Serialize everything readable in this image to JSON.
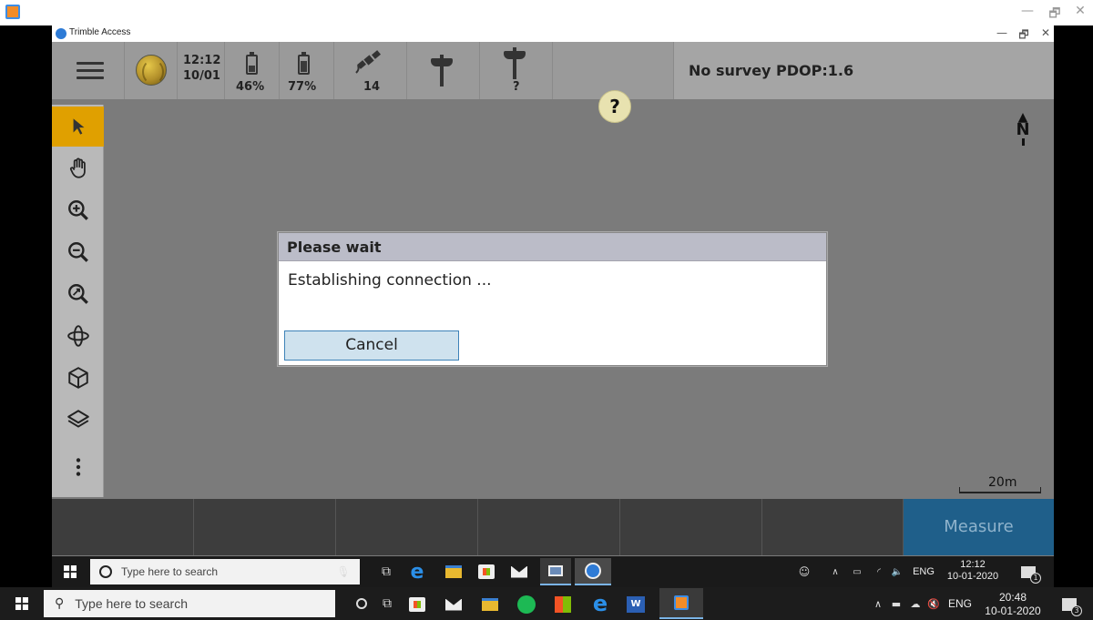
{
  "host": {
    "logo_icon": "app-logo-icon",
    "minimize": "—",
    "maximize": "🗗",
    "close": "✕"
  },
  "window": {
    "title": "Trimble Access",
    "minimize": "—",
    "maximize": "🗗",
    "close": "✕"
  },
  "statusbar": {
    "time": "12:12",
    "date": "10/01",
    "battery1": "46%",
    "battery1_level": 0.46,
    "battery2": "77%",
    "battery2_level": 0.77,
    "satellites": "14",
    "antenna2_label": "?",
    "survey_status": "No survey  PDOP:1.6"
  },
  "help_cursor": "?",
  "toolbar": {
    "items": [
      {
        "name": "select-arrow-icon",
        "active": true
      },
      {
        "name": "pan-hand-icon"
      },
      {
        "name": "zoom-in-icon"
      },
      {
        "name": "zoom-out-icon"
      },
      {
        "name": "zoom-extents-icon"
      },
      {
        "name": "orbit-icon"
      },
      {
        "name": "cube-view-icon"
      },
      {
        "name": "layers-icon"
      },
      {
        "name": "more-icon"
      }
    ]
  },
  "map": {
    "north_label": "N",
    "scale_label": "20m"
  },
  "softkeys": {
    "measure_label": "Measure"
  },
  "dialog": {
    "title": "Please wait",
    "message": "Establishing connection ...",
    "cancel_label": "Cancel"
  },
  "inner_taskbar": {
    "search_placeholder": "Type here to search",
    "time": "12:12",
    "date": "10-01-2020",
    "lang": "ENG",
    "notif_count": "1"
  },
  "outer_taskbar": {
    "search_placeholder": "Type here to search",
    "time": "20:48",
    "date": "10-01-2020",
    "lang": "ENG",
    "notif_count": "3"
  },
  "colors": {
    "accent_active_tool": "#e0a000",
    "measure_button": "#1f5f8a",
    "dialog_button": "#cfe2ee"
  }
}
